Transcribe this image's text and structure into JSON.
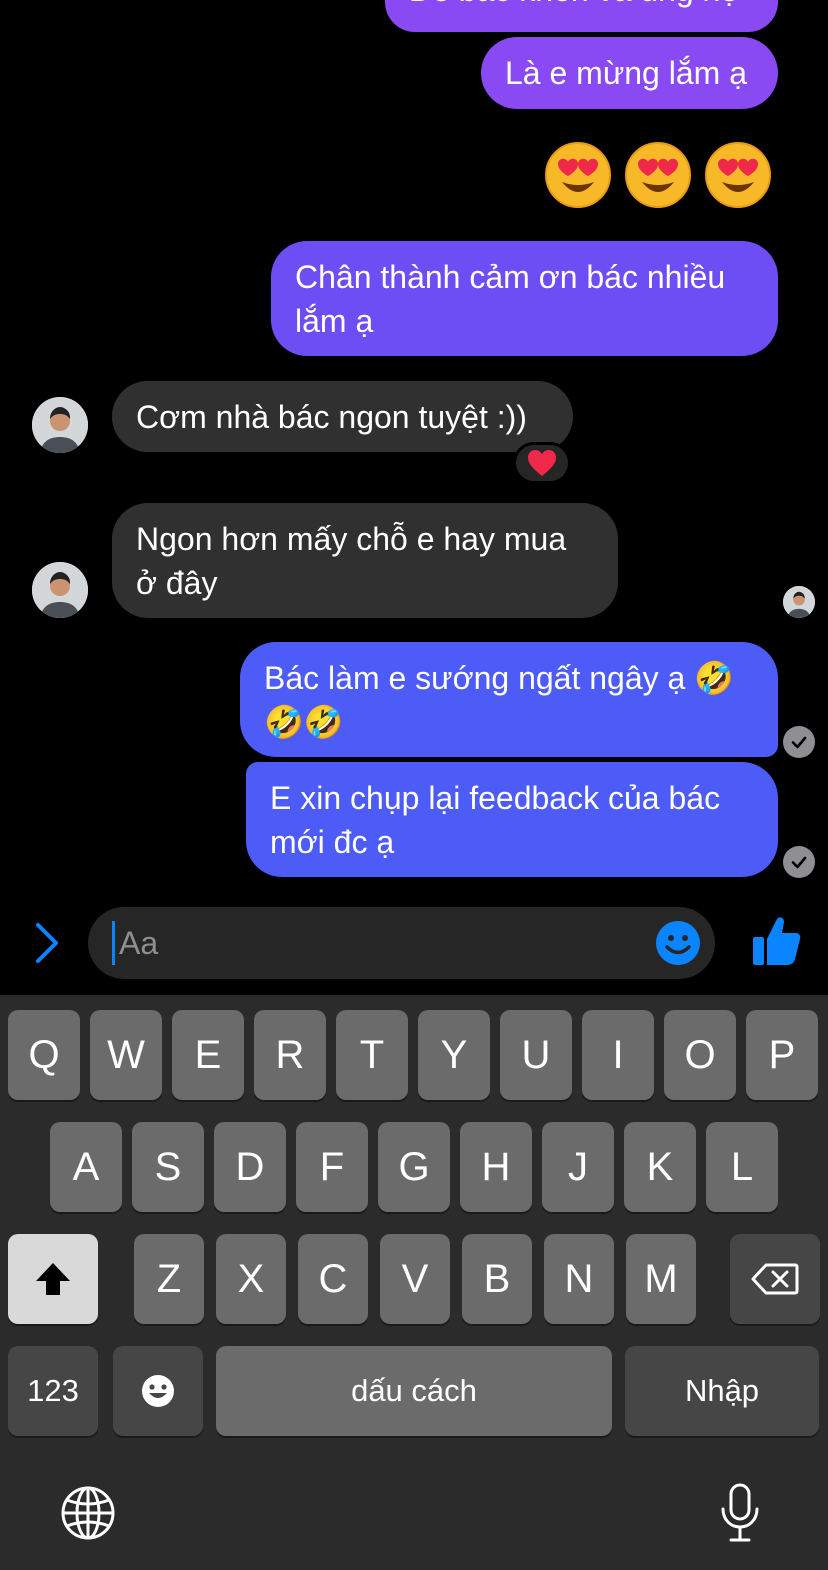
{
  "messages": {
    "partial_top": "Để bác khen và ủng hộ",
    "m1": "Là e mừng lắm ạ",
    "m2": "Chân thành cảm ơn bác nhiều lắm ạ",
    "m3": "Cơm nhà bác ngon tuyệt :))",
    "m4": "Ngon hơn mấy chỗ e hay mua ở đây",
    "m5_line1": "Bác làm e sướng ngất ngây ạ 🤣",
    "m5_line2": "🤣🤣",
    "m6": "E xin chụp lại feedback của bác mới đc ạ"
  },
  "composer": {
    "placeholder": "Aa",
    "icons": [
      "chevron-right-icon",
      "smiley-icon",
      "thumbs-up-icon"
    ]
  },
  "keyboard": {
    "row1": [
      "Q",
      "W",
      "E",
      "R",
      "T",
      "Y",
      "U",
      "I",
      "O",
      "P"
    ],
    "row2": [
      "A",
      "S",
      "D",
      "F",
      "G",
      "H",
      "J",
      "K",
      "L"
    ],
    "row3": [
      "Z",
      "X",
      "C",
      "V",
      "B",
      "N",
      "M"
    ],
    "numbers_label": "123",
    "space_label": "dấu cách",
    "return_label": "Nhập"
  },
  "colors": {
    "bubble_purple": "#8a4af3",
    "bubble_violet": "#6d4ef5",
    "bubble_blue": "#4d5cf7",
    "bubble_incoming": "#303030",
    "accent": "#0a84ff"
  }
}
